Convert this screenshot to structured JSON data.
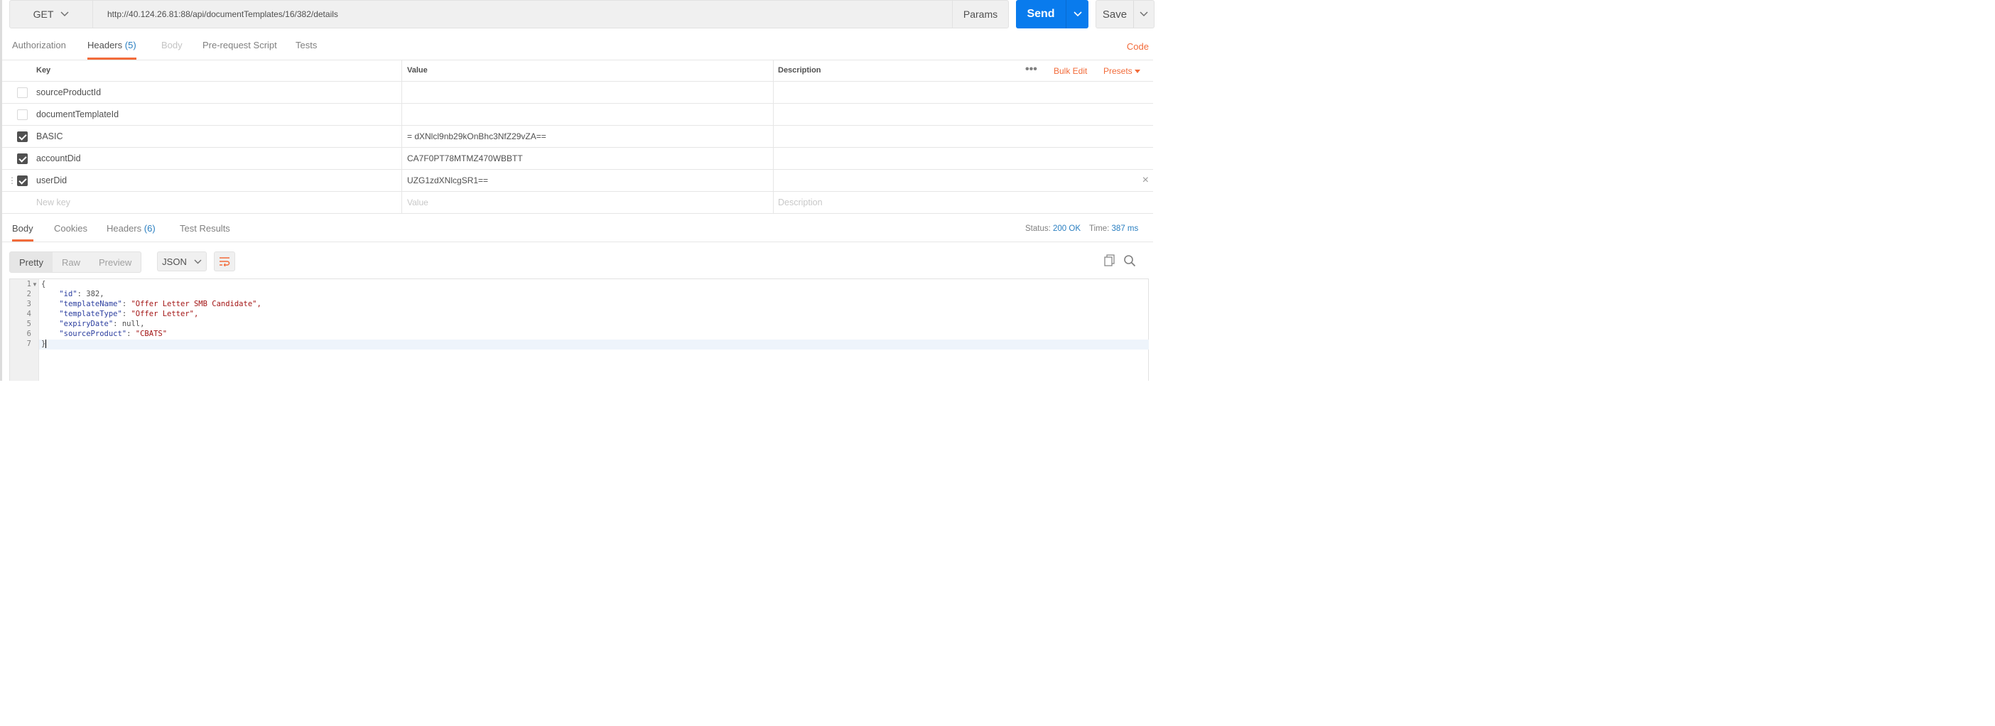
{
  "request": {
    "method": "GET",
    "url": "http://40.124.26.81:88/api/documentTemplates/16/382/details",
    "params_label": "Params",
    "send_label": "Send",
    "save_label": "Save"
  },
  "request_tabs": {
    "authorization": "Authorization",
    "headers": "Headers",
    "headers_count": "(5)",
    "body": "Body",
    "prerequest": "Pre-request Script",
    "tests": "Tests",
    "code": "Code"
  },
  "headers_table": {
    "col_key": "Key",
    "col_value": "Value",
    "col_description": "Description",
    "more": "•••",
    "bulk_edit": "Bulk Edit",
    "presets": "Presets",
    "rows": [
      {
        "key": "sourceProductId",
        "value": "",
        "checked": false
      },
      {
        "key": "documentTemplateId",
        "value": "",
        "checked": false
      },
      {
        "key": "BASIC",
        "value": "= dXNlcl9nb29kOnBhc3NfZ29vZA==",
        "checked": true
      },
      {
        "key": "accountDid",
        "value": " CA7F0PT78MTMZ470WBBTT",
        "checked": true
      },
      {
        "key": "userDid",
        "value": "UZG1zdXNlcgSR1==",
        "checked": true
      }
    ],
    "new_key_placeholder": "New key",
    "value_placeholder": "Value",
    "description_placeholder": "Description"
  },
  "response_tabs": {
    "body": "Body",
    "cookies": "Cookies",
    "headers": "Headers",
    "headers_count": "(6)",
    "test_results": "Test Results",
    "status_label": "Status:",
    "status_value": "200 OK",
    "time_label": "Time:",
    "time_value": "387 ms"
  },
  "response_toolbar": {
    "pretty": "Pretty",
    "raw": "Raw",
    "preview": "Preview",
    "format": "JSON"
  },
  "response_body": {
    "line_numbers": [
      "1",
      "2",
      "3",
      "4",
      "5",
      "6",
      "7"
    ],
    "open": "{",
    "id_key": "\"id\"",
    "id_val": "382,",
    "name_key": "\"templateName\"",
    "name_val": "\"Offer Letter SMB Candidate\",",
    "type_key": "\"templateType\"",
    "type_val": "\"Offer Letter\",",
    "expiry_key": "\"expiryDate\"",
    "expiry_val": "null,",
    "src_key": "\"sourceProduct\"",
    "src_val": "\"CBATS\"",
    "close": "}"
  },
  "colors": {
    "accent": "#f26b3a",
    "send": "#097bed",
    "link": "#2a7fc1"
  }
}
